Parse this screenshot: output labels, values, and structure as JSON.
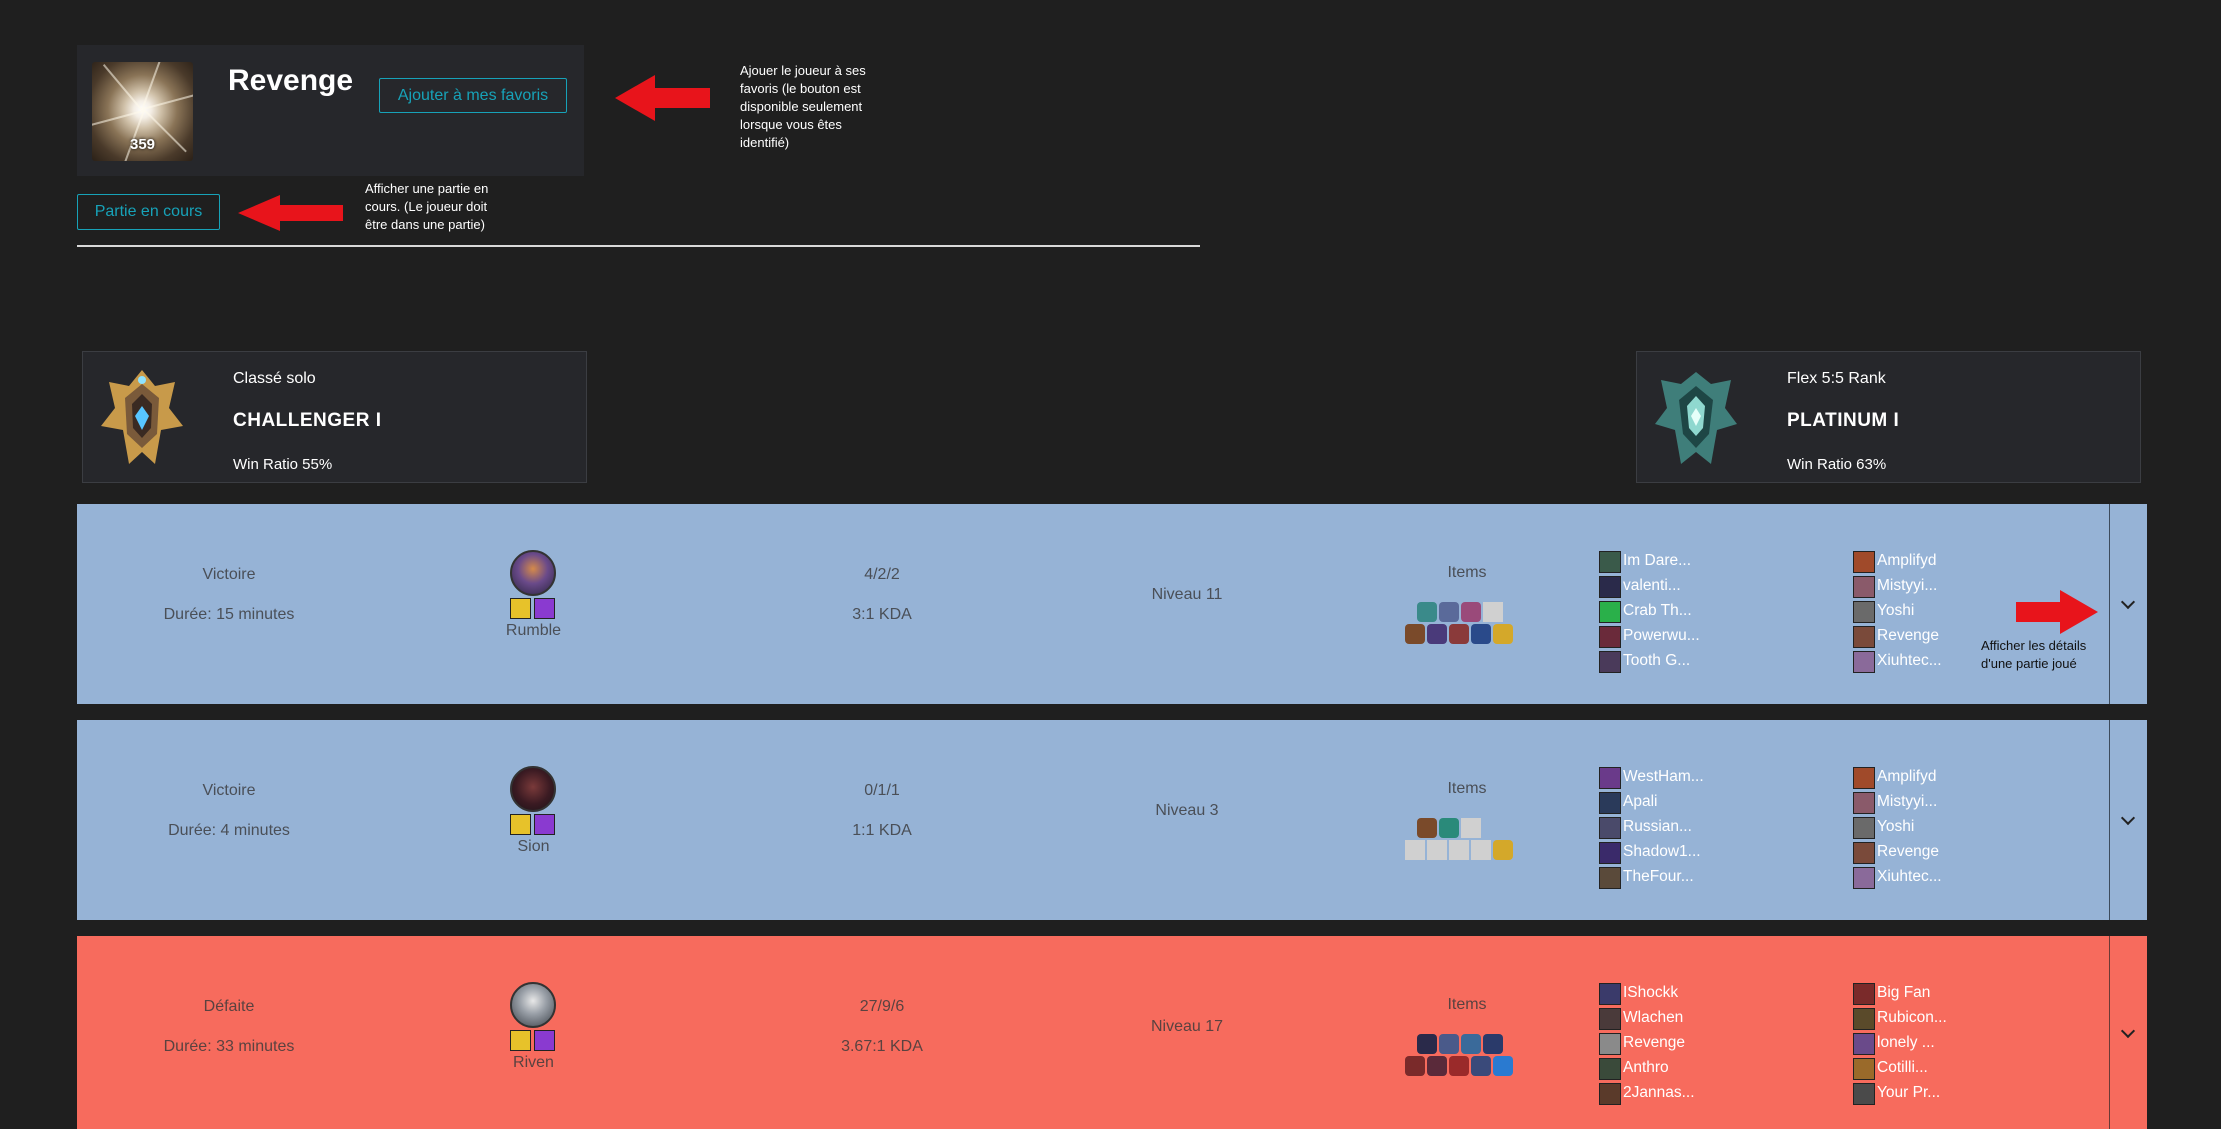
{
  "profile": {
    "name": "Revenge",
    "level": "359",
    "favorite_button": "Ajouter à mes favoris",
    "live_game_button": "Partie en cours"
  },
  "notes": {
    "favorite": [
      "Ajouer le joueur à ses",
      "favoris (le bouton est",
      "disponible seulement",
      "lorsque vous êtes",
      "identifié)"
    ],
    "live_game": [
      "Afficher une partie en",
      "cours. (Le joueur doit",
      "être dans une partie)"
    ],
    "details": [
      "Afficher les détails",
      "d'une partie joué"
    ]
  },
  "ranks": [
    {
      "queue": "Classé solo",
      "tier": "CHALLENGER I",
      "win_ratio": "Win Ratio 55%"
    },
    {
      "queue": "Flex 5:5 Rank",
      "tier": "PLATINUM I",
      "win_ratio": "Win Ratio 63%"
    }
  ],
  "matches": [
    {
      "result": "Victoire",
      "duration": "Durée: 15 minutes",
      "champion": "Rumble",
      "score": "4/2/2",
      "kda": "3:1 KDA",
      "level": "Niveau 11",
      "items_label": "Items",
      "team1": [
        "Im Dare...",
        "valenti...",
        "Crab Th...",
        "Powerwu...",
        "Tooth G..."
      ],
      "team2": [
        "Amplifyd",
        "Mistyyi...",
        "Yoshi",
        "Revenge",
        "Xiuhtec..."
      ]
    },
    {
      "result": "Victoire",
      "duration": "Durée: 4 minutes",
      "champion": "Sion",
      "score": "0/1/1",
      "kda": "1:1 KDA",
      "level": "Niveau 3",
      "items_label": "Items",
      "team1": [
        "WestHam...",
        "Apali",
        "Russian...",
        "Shadow1...",
        "TheFour..."
      ],
      "team2": [
        "Amplifyd",
        "Mistyyi...",
        "Yoshi",
        "Revenge",
        "Xiuhtec..."
      ]
    },
    {
      "result": "Défaite",
      "duration": "Durée: 33 minutes",
      "champion": "Riven",
      "score": "27/9/6",
      "kda": "3.67:1 KDA",
      "level": "Niveau 17",
      "items_label": "Items",
      "team1": [
        "IShockk",
        "Wlachen",
        "Revenge",
        "Anthro",
        "2Jannas..."
      ],
      "team2": [
        "Big Fan",
        "Rubicon...",
        "lonely ...",
        "Cotilli...",
        "Your Pr..."
      ]
    }
  ],
  "colors": {
    "win": "#96b3d6",
    "loss": "#f76b5d",
    "accent": "#17a2b8",
    "annotation_arrow": "#e8141b"
  }
}
